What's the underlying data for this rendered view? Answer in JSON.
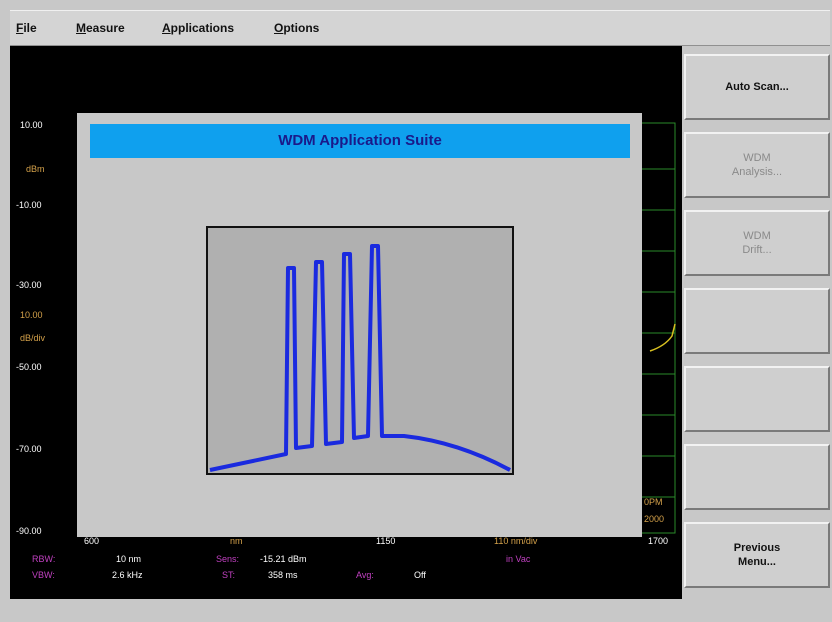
{
  "menubar": {
    "items": [
      {
        "mn": "F",
        "rest": "ile"
      },
      {
        "mn": "M",
        "rest": "easure"
      },
      {
        "mn": "A",
        "rest": "pplications"
      },
      {
        "mn": "O",
        "rest": "ptions"
      }
    ]
  },
  "screen": {
    "y_ticks": [
      "10.00",
      "-10.00",
      "-30.00",
      "-50.00",
      "-70.00",
      "-90.00"
    ],
    "y_unit": "dBm",
    "scale": "10.00",
    "scale_unit": "dB/div",
    "x_start": "600",
    "x_unit": "nm",
    "x_center": "1150",
    "x_span": "110 nm/div",
    "x_stop": "1700",
    "rbw_label": "RBW:",
    "rbw_value": "10 nm",
    "sens_label": "Sens:",
    "sens_value": "-15.21 dBm",
    "vbw_label": "VBW:",
    "vbw_value": "2.6 kHz",
    "st_label": "ST:",
    "st_value": "358 ms",
    "avg_label": "Avg:",
    "avg_value": "Off",
    "medium": "in Vac",
    "ppm_a": "0PM",
    "ppm_b": "2000"
  },
  "dialog": {
    "title": "WDM Application Suite"
  },
  "softkeys": [
    {
      "label": "Auto Scan...",
      "enabled": true
    },
    {
      "label": "WDM\nAnalysis...",
      "enabled": false
    },
    {
      "label": "WDM\nDrift...",
      "enabled": false
    },
    {
      "label": "",
      "enabled": false
    },
    {
      "label": "",
      "enabled": false
    },
    {
      "label": "",
      "enabled": false
    },
    {
      "label": "Previous\nMenu...",
      "enabled": true
    }
  ],
  "colors": {
    "title_bar": "#0fa0ee",
    "trace": "#1a2adf",
    "grid_green": "#2a8a2a",
    "trace_yellow": "#d8c020"
  }
}
